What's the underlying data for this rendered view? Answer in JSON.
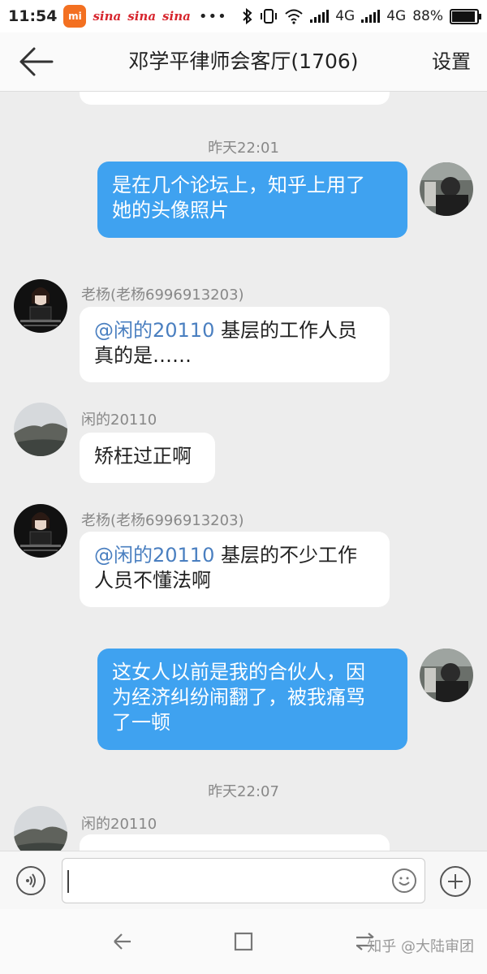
{
  "status_bar": {
    "time": "11:54",
    "mi_label": "mi",
    "sina_label": "sina",
    "more": "•••",
    "network1": "4G",
    "network2": "4G",
    "battery_percent": "88%",
    "battery_level": 0.88
  },
  "header": {
    "title": "邓学平律师会客厅(1706)",
    "settings_label": "设置"
  },
  "messages": [
    {
      "type": "timestamp",
      "text": "昨天22:01"
    },
    {
      "type": "outgoing",
      "lines": [
        "是在几个论坛上，知乎上用了",
        "她的头像照片"
      ]
    },
    {
      "type": "incoming",
      "sender": "老杨(老杨6996913203)",
      "mention": "@闲的20110",
      "lines": [
        " 基层的工作人员",
        "真的是……"
      ]
    },
    {
      "type": "incoming",
      "sender": "闲的20110",
      "lines": [
        "矫枉过正啊"
      ]
    },
    {
      "type": "incoming",
      "sender": "老杨(老杨6996913203)",
      "mention": "@闲的20110",
      "lines": [
        " 基层的不少工作",
        "人员不懂法啊"
      ]
    },
    {
      "type": "outgoing",
      "lines": [
        "这女人以前是我的合伙人，因",
        "为经济纠纷闹翻了，被我痛骂",
        "了一顿"
      ]
    },
    {
      "type": "timestamp",
      "text": "昨天22:07"
    },
    {
      "type": "incoming",
      "sender": "闲的20110",
      "lines": [
        ""
      ]
    }
  ],
  "input_bar": {
    "text_value": "",
    "placeholder": ""
  },
  "watermark": "知乎 @大陆审团",
  "colors": {
    "outgoing_bubble": "#3fa2f0",
    "incoming_bubble": "#ffffff",
    "mention": "#4a7fc0",
    "background": "#ededed"
  },
  "icons": [
    "back-arrow-icon",
    "voice-icon",
    "emoji-icon",
    "plus-icon",
    "nav-back-icon",
    "nav-home-icon",
    "nav-recents-icon",
    "nav-menu-icon",
    "bluetooth-icon",
    "vibrate-icon",
    "wifi-icon",
    "signal-icon",
    "battery-icon"
  ]
}
